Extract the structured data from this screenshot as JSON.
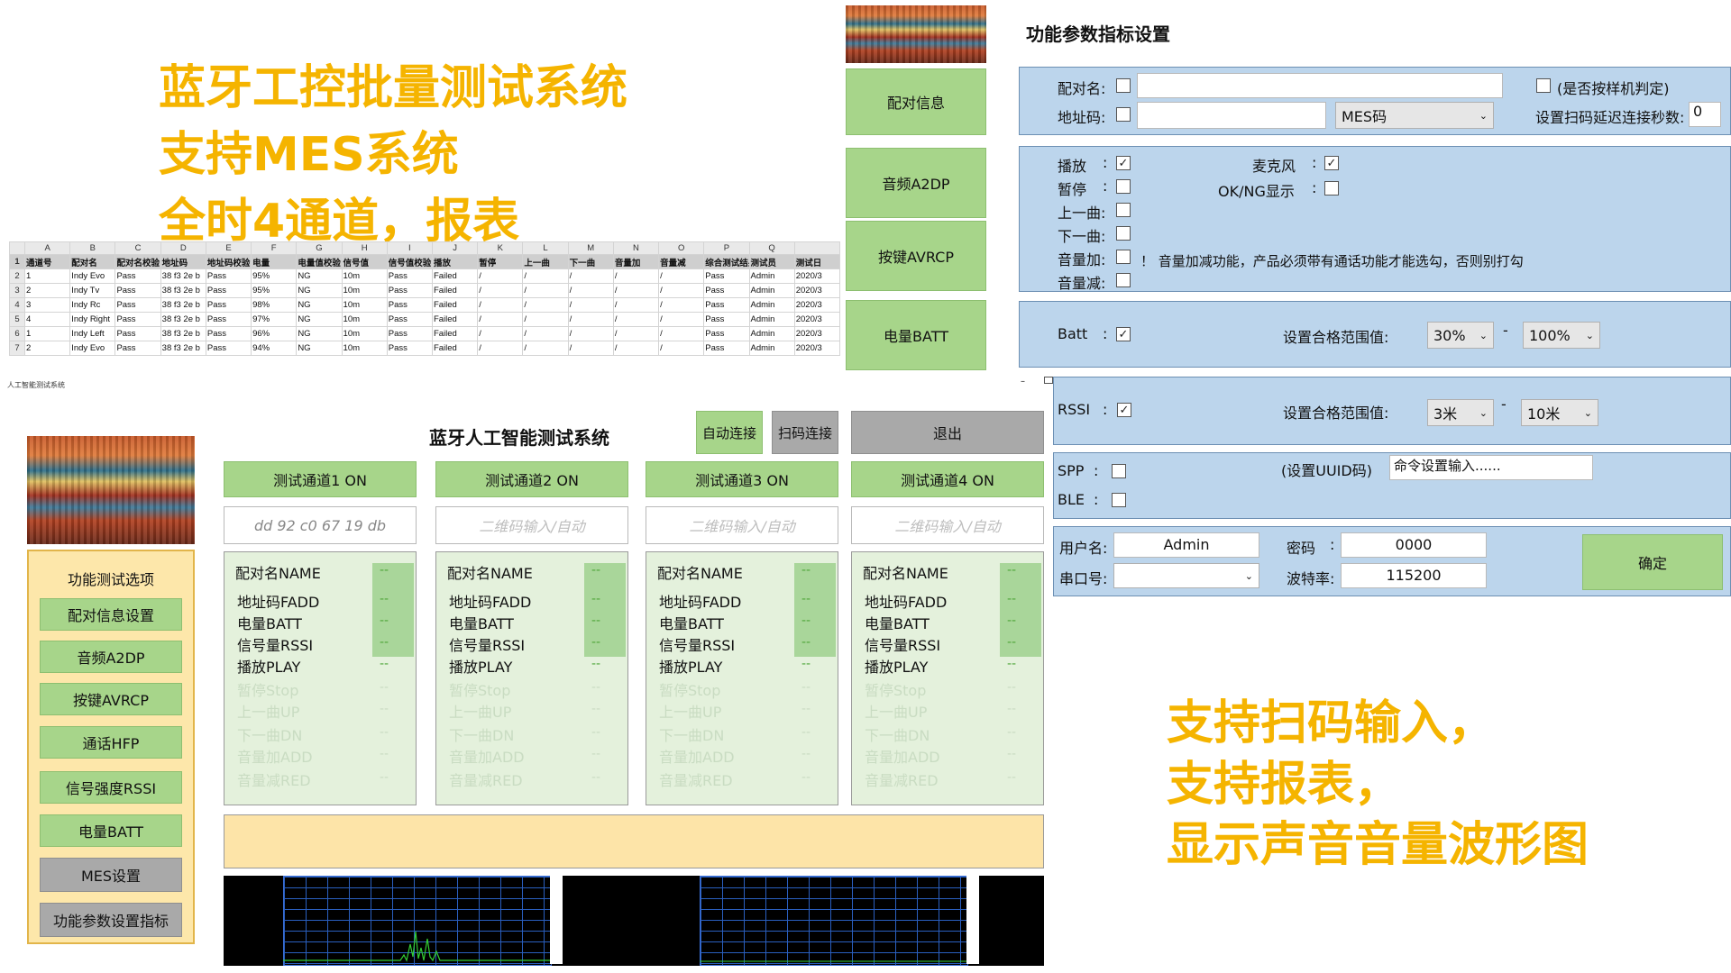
{
  "promo_top": [
    "蓝牙工控批量测试系统",
    "支持MES系统",
    "全时4通道，报表"
  ],
  "promo_bottom": [
    "支持扫码输入，",
    "支持报表，",
    "显示声音音量波形图"
  ],
  "sheet": {
    "col_letters": [
      "A",
      "B",
      "C",
      "D",
      "E",
      "F",
      "G",
      "H",
      "I",
      "J",
      "K",
      "L",
      "M",
      "N",
      "O",
      "P",
      "Q",
      ""
    ],
    "headers": [
      "通道号",
      "配对名",
      "配对名校验",
      "地址码",
      "地址码校验",
      "电量",
      "电量值校验",
      "信号值",
      "信号值校验",
      "播放",
      "暂停",
      "上一曲",
      "下一曲",
      "音量加",
      "音量减",
      "综合测试结果",
      "测试员",
      "测试日"
    ],
    "rows": [
      [
        "1",
        "Indy Evo",
        "Pass",
        "38 f3 2e b",
        "Pass",
        "95%",
        "NG",
        "10m",
        "Pass",
        "Failed",
        "/",
        "/",
        "/",
        "/",
        "/",
        "Pass",
        "Admin",
        "2020/3"
      ],
      [
        "2",
        "Indy Tv",
        "Pass",
        "38 f3 2e b",
        "Pass",
        "95%",
        "NG",
        "10m",
        "Pass",
        "Failed",
        "/",
        "/",
        "/",
        "/",
        "/",
        "Pass",
        "Admin",
        "2020/3"
      ],
      [
        "3",
        "Indy Rc",
        "Pass",
        "38 f3 2e b",
        "Pass",
        "98%",
        "NG",
        "10m",
        "Pass",
        "Failed",
        "/",
        "/",
        "/",
        "/",
        "/",
        "Pass",
        "Admin",
        "2020/3"
      ],
      [
        "4",
        "Indy Right",
        "Pass",
        "38 f3 2e b",
        "Pass",
        "97%",
        "NG",
        "10m",
        "Pass",
        "Failed",
        "/",
        "/",
        "/",
        "/",
        "/",
        "Pass",
        "Admin",
        "2020/3"
      ],
      [
        "1",
        "Indy Left",
        "Pass",
        "38 f3 2e b",
        "Pass",
        "96%",
        "NG",
        "10m",
        "Pass",
        "Failed",
        "/",
        "/",
        "/",
        "/",
        "/",
        "Pass",
        "Admin",
        "2020/3"
      ],
      [
        "2",
        "Indy Evo",
        "Pass",
        "38 f3 2e b",
        "Pass",
        "94%",
        "NG",
        "10m",
        "Pass",
        "Failed",
        "/",
        "/",
        "/",
        "/",
        "/",
        "Pass",
        "Admin",
        "2020/3"
      ]
    ]
  },
  "main_window": {
    "caption": "人工智能测试系统",
    "title": "蓝牙人工智能测试系统",
    "buttons": {
      "auto_connect": "自动连接",
      "scan_connect": "扫码连接",
      "exit": "退出"
    },
    "sidebar_title": "功能测试选项",
    "sidebar_items": [
      "配对信息设置",
      "音频A2DP",
      "按键AVRCP",
      "通话HFP",
      "信号强度RSSI",
      "电量BATT",
      "MES设置",
      "功能参数设置指标"
    ],
    "channels": [
      {
        "label": "测试通道1 ON",
        "input": "dd 92 c0 67 19 db",
        "placeholder": ""
      },
      {
        "label": "测试通道2 ON",
        "input": "",
        "placeholder": "二维码输入/自动"
      },
      {
        "label": "测试通道3 ON",
        "input": "",
        "placeholder": "二维码输入/自动"
      },
      {
        "label": "测试通道4 ON",
        "input": "",
        "placeholder": "二维码输入/自动"
      }
    ],
    "panel_rows": [
      "配对名NAME",
      "地址码FADD",
      "电量BATT",
      "信号量RSSI",
      "播放PLAY",
      "暂停Stop",
      "上一曲UP",
      "下一曲DN",
      "音量加ADD",
      "音量减RED"
    ],
    "panel_value": "--"
  },
  "settings": {
    "title": "功能参数指标设置",
    "nav": [
      "配对信息",
      "音频A2DP",
      "按键AVRCP",
      "电量BATT"
    ],
    "pair": {
      "name_label": "配对名:",
      "addr_label": "地址码:",
      "mes_select": "MES码",
      "sample_label": "(是否按样机判定)",
      "delay_label": "设置扫码延迟连接秒数:",
      "delay_value": "0"
    },
    "audio": {
      "play": "播放",
      "pause": "暂停",
      "prev": "上一曲:",
      "next": "下一曲:",
      "volup": "音量加:",
      "voldown": "音量减:",
      "mic": "麦克风",
      "okng": "OK/NG显示",
      "note": "！ 音量加减功能，产品必须带有通话功能才能选勾，否则别打勾"
    },
    "batt": {
      "label": "Batt",
      "range_label": "设置合格范围值:",
      "min": "30%",
      "max": "100%"
    },
    "rssi": {
      "label": "RSSI",
      "range_label": "设置合格范围值:",
      "min": "3米",
      "max": "10米"
    },
    "spp": {
      "label": "SPP",
      "ble": "BLE",
      "uuid_label": "(设置UUID码)",
      "uuid_value": "命令设置输入......"
    },
    "login": {
      "user_label": "用户名:",
      "user_value": "Admin",
      "pwd_label": "密码",
      "pwd_value": "0000",
      "port_label": "串口号:",
      "baud_label": "波特率:",
      "baud_value": "115200",
      "ok": "确定"
    },
    "colon": ":",
    "dash": "-",
    "check": "✓"
  },
  "colors": {
    "promo": "#f5b400",
    "button_green": "#a7d58a",
    "panel_blue": "#bcd5ec",
    "panel_green": "#e4f1dc",
    "bar_yellow": "#fde4a8"
  }
}
